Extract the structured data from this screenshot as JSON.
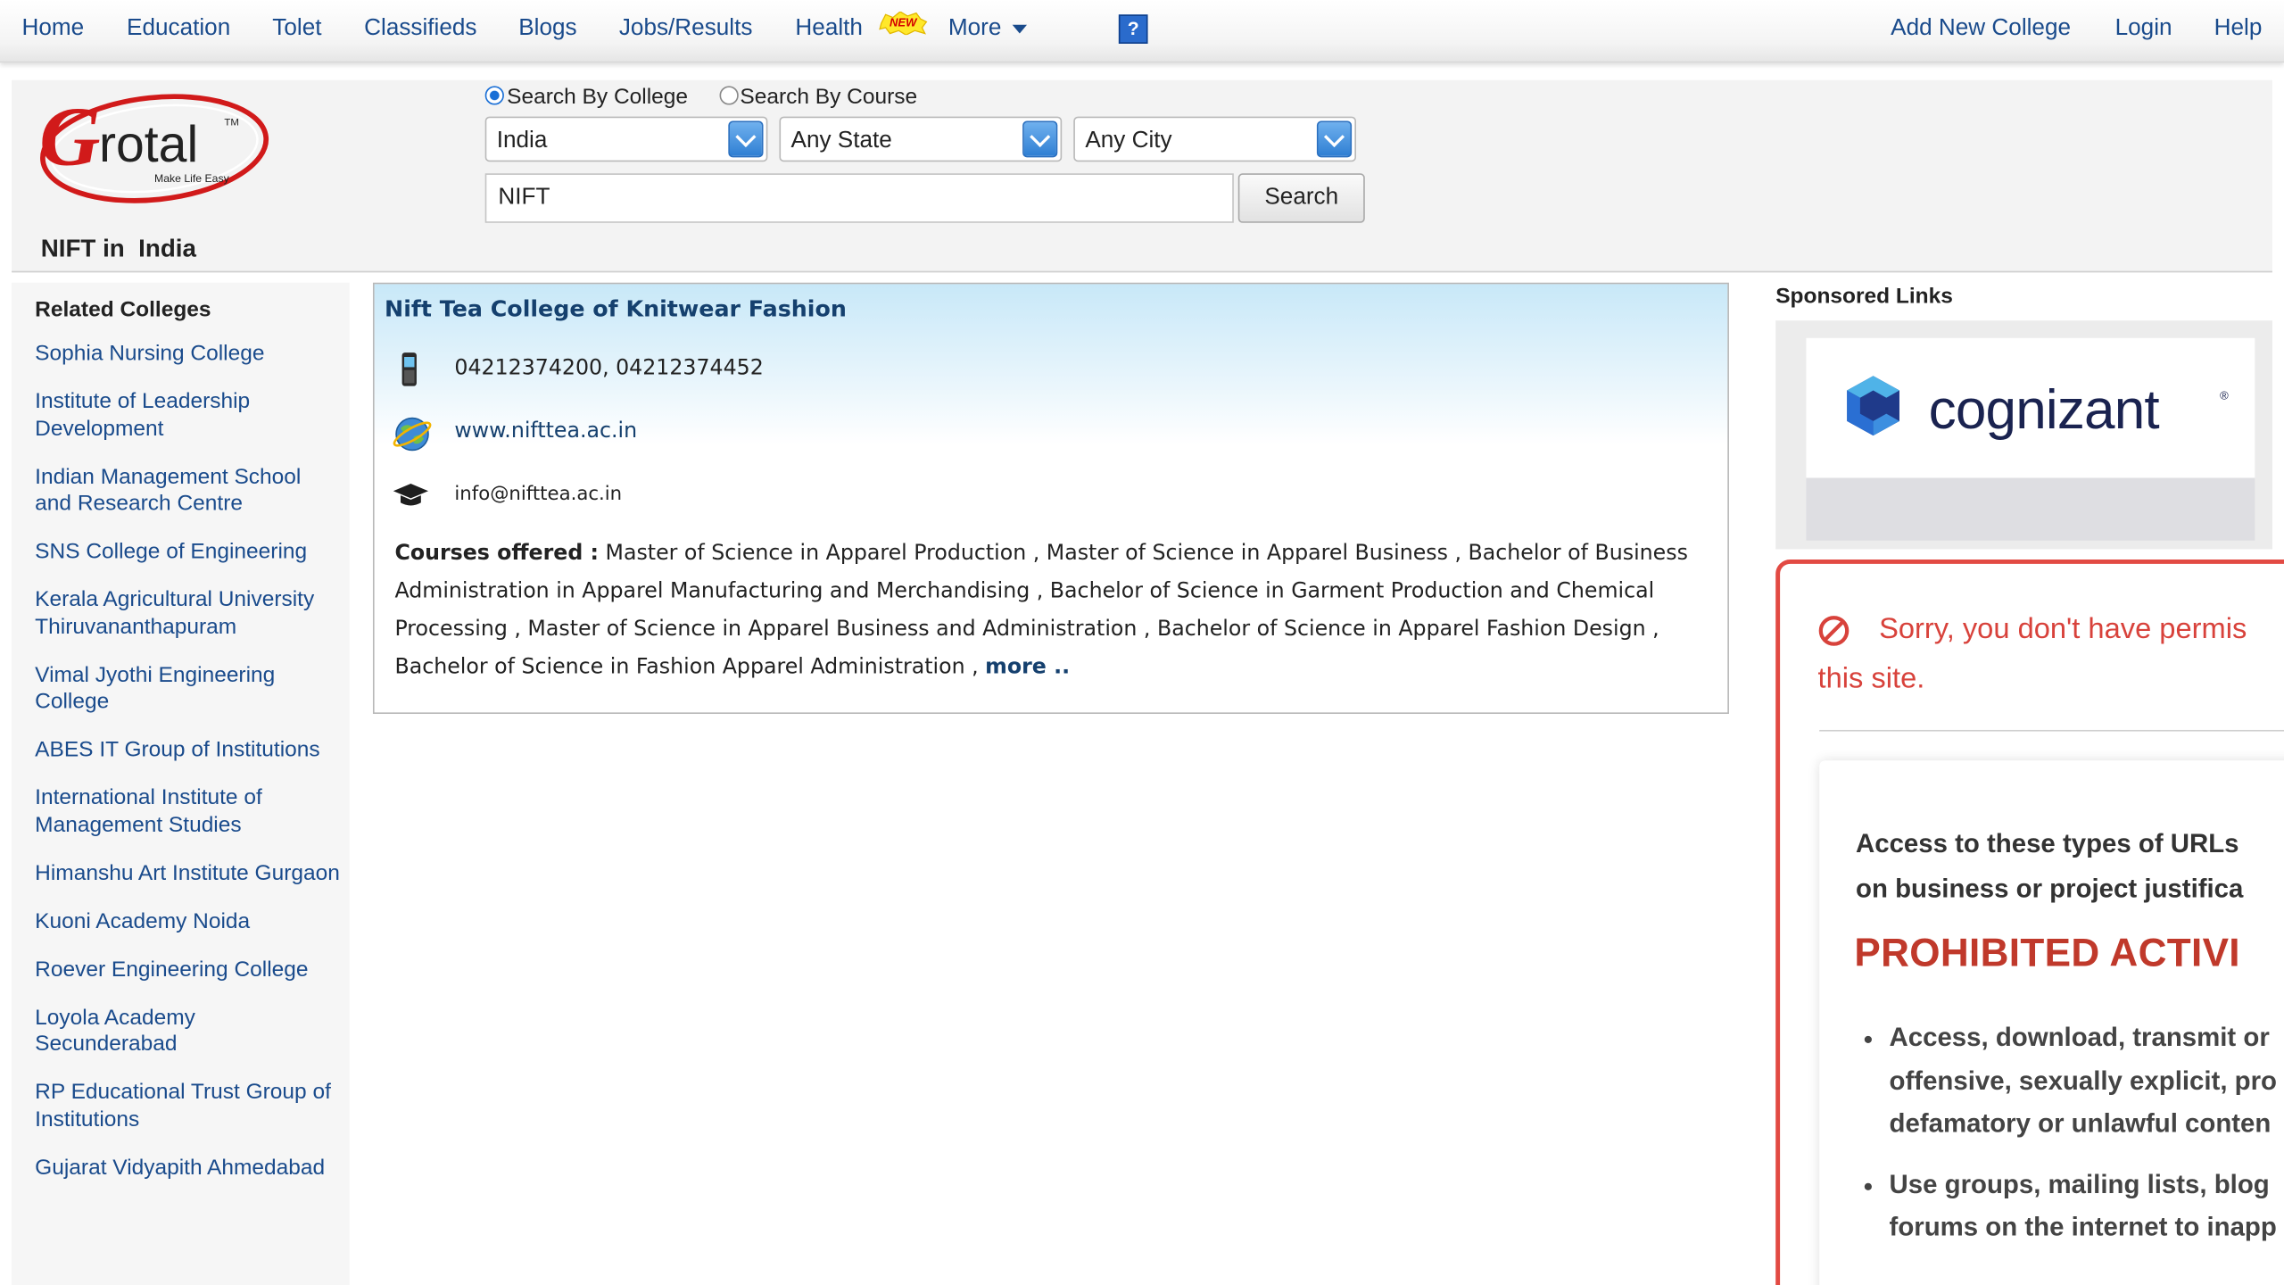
{
  "nav": {
    "left": [
      {
        "id": "home",
        "label": "Home"
      },
      {
        "id": "education",
        "label": "Education"
      },
      {
        "id": "tolet",
        "label": "Tolet"
      },
      {
        "id": "classifieds",
        "label": "Classifieds"
      },
      {
        "id": "blogs",
        "label": "Blogs"
      },
      {
        "id": "jobs",
        "label": "Jobs/Results"
      },
      {
        "id": "health",
        "label": "Health"
      },
      {
        "id": "more",
        "label": "More"
      }
    ],
    "new_badge": "NEW",
    "help_icon": "?",
    "right": [
      {
        "id": "add-college",
        "label": "Add New College"
      },
      {
        "id": "login",
        "label": "Login"
      },
      {
        "id": "help",
        "label": "Help"
      }
    ]
  },
  "logo": {
    "brand": "Grotal",
    "tagline": "Make Life Easy",
    "tm": "TM"
  },
  "search": {
    "mode_college": "Search By College",
    "mode_course": "Search By Course",
    "country": "India",
    "state": "Any State",
    "city": "Any City",
    "query": "NIFT",
    "button": "Search"
  },
  "page_title": "NIFT in  India",
  "related": {
    "heading": "Related Colleges",
    "items": [
      "Sophia Nursing College",
      "Institute of Leadership Development",
      "Indian Management School and Research Centre",
      "SNS College of Engineering",
      "Kerala Agricultural University Thiruvananthapuram",
      "Vimal Jyothi Engineering College",
      "ABES IT Group of Institutions",
      "International Institute of Management Studies",
      "Himanshu Art Institute Gurgaon",
      "Kuoni Academy Noida",
      "Roever Engineering College",
      "Loyola Academy Secunderabad",
      "RP Educational Trust Group of Institutions",
      "Gujarat Vidyapith Ahmedabad"
    ]
  },
  "result": {
    "name": "Nift Tea College of Knitwear Fashion",
    "phone": "04212374200, 04212374452",
    "website": "www.nifttea.ac.in",
    "email": "info@nifttea.ac.in",
    "courses_label": "Courses offered :",
    "courses": " Master of Science in Apparel Production , Master of Science in Apparel Business , Bachelor of Business Administration in Apparel Manufacturing and Merchandising , Bachelor of Science in Garment Production and Chemical Processing , Master of Science in Apparel Business and Administration , Bachelor of Science in Apparel Fashion Design , Bachelor of Science in Fashion Apparel Administration , ",
    "more": "more .."
  },
  "sponsored": {
    "heading": "Sponsored Links",
    "ad_brand": "cognizant",
    "ad_reg": "®"
  },
  "blocked": {
    "message_line1": "Sorry, you don't have permis",
    "message_line2": "this site.",
    "access_line1": "Access to these types of URLs",
    "access_line2": "on business or project justifica",
    "heading": "PROHIBITED ACTIVI",
    "bullet1_line1": "Access, download, transmit or",
    "bullet1_line2": "offensive, sexually explicit, pro",
    "bullet1_line3": "defamatory or unlawful conten",
    "bullet2_line1": "Use groups, mailing lists, blog",
    "bullet2_line2": "forums on the internet to inapp"
  },
  "colors": {
    "link": "#1a4b8c",
    "title_blue": "#15406e",
    "alert_red": "#d8423b",
    "accent_blue": "#2f7fd3"
  }
}
